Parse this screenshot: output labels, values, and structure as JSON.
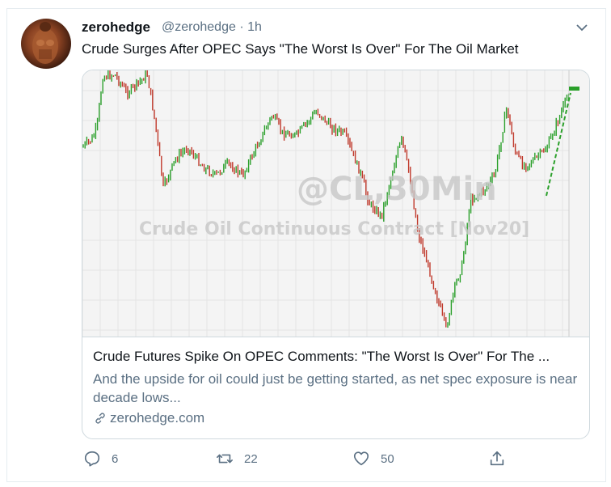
{
  "tweet": {
    "author_name": "zerohedge",
    "handle": "@zerohedge",
    "separator": "·",
    "time": "1h",
    "text": "Crude Surges After OPEC Says \"The Worst Is Over\" For The Oil Market"
  },
  "card": {
    "image_watermark": "@CL,30Min",
    "image_subtitle": "Crude Oil Continuous Contract [Nov20]",
    "title": "Crude Futures Spike On OPEC Comments: \"The Worst Is Over\" For The ...",
    "description": "And the upside for oil could just be getting started, as net spec exposure is near decade lows...",
    "domain": "zerohedge.com"
  },
  "actions": {
    "replies": "6",
    "retweets": "22",
    "likes": "50"
  },
  "icons": [
    "avatar-image",
    "chevron-down-icon",
    "link-icon",
    "reply-icon",
    "retweet-icon",
    "like-icon",
    "share-icon"
  ],
  "colors": {
    "candle_up": "#2ba02b",
    "candle_down": "#c0392b",
    "secondary_text": "#5b7083"
  }
}
